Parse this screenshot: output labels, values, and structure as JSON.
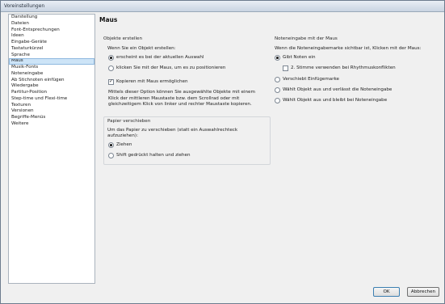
{
  "window": {
    "title": "Voreinstellungen"
  },
  "sidebar": {
    "items": [
      "Darstellung",
      "Dateien",
      "Font-Entsprechungen",
      "Ideen",
      "Eingabe-Geräte",
      "Tastaturkürzel",
      "Sprache",
      "Maus",
      "Musik-Fonts",
      "Noteneingabe",
      "Ab Stichnoten einfügen",
      "Wiedergabe",
      "Partitur-Position",
      "Step-time und Flexi-time",
      "Texturen",
      "Versionen",
      "Begriffe-Menüs",
      "Weitere"
    ],
    "selected_index": 7
  },
  "main": {
    "heading": "Maus",
    "objects": {
      "title": "Objekte erstellen",
      "prompt": "Wenn Sie ein Objekt erstellen:",
      "option1": "erscheint es bei der aktuellen Auswahl",
      "option2": "klicken Sie mit der Maus, um es zu positionieren",
      "copy_checkbox": "Kopieren mit Maus ermöglichen",
      "desc_line1": "Mittels dieser Option können Sie ausgewählte Objekte mit einem",
      "desc_line2": "Klick der mittleren Maustaste bzw. dem Scrollrad oder mit",
      "desc_line3": "gleichzeitigem Klick von linker und rechter Maustaste kopieren."
    },
    "paper": {
      "title": "Papier verschieben",
      "prompt_line1": "Um das Papier zu verschieben (statt ein Auswahlrechteck",
      "prompt_line2": "aufzuziehen):",
      "option1": "Ziehen",
      "option2": "Shift gedrückt halten und ziehen"
    },
    "note_input": {
      "title": "Noteneingabe mit der Maus",
      "prompt": "Wenn die Noteneingabemarke sichtbar ist, Klicken mit der Maus:",
      "option1": "Gibt Noten ein",
      "sub_checkbox": "2. Stimme verwenden bei Rhythmuskonflikten",
      "option2": "Verschiebt Einfügemarke",
      "option3": "Wählt Objekt aus und verlässt die Noteneingabe",
      "option4": "Wählt Objekt aus und bleibt bei Noteneingabe"
    }
  },
  "buttons": {
    "ok": "OK",
    "cancel": "Abbrechen"
  },
  "state": {
    "objects_selected": 1,
    "copy_checked": true,
    "paper_selected": 1,
    "note_selected": 1,
    "sub_checked": false
  }
}
